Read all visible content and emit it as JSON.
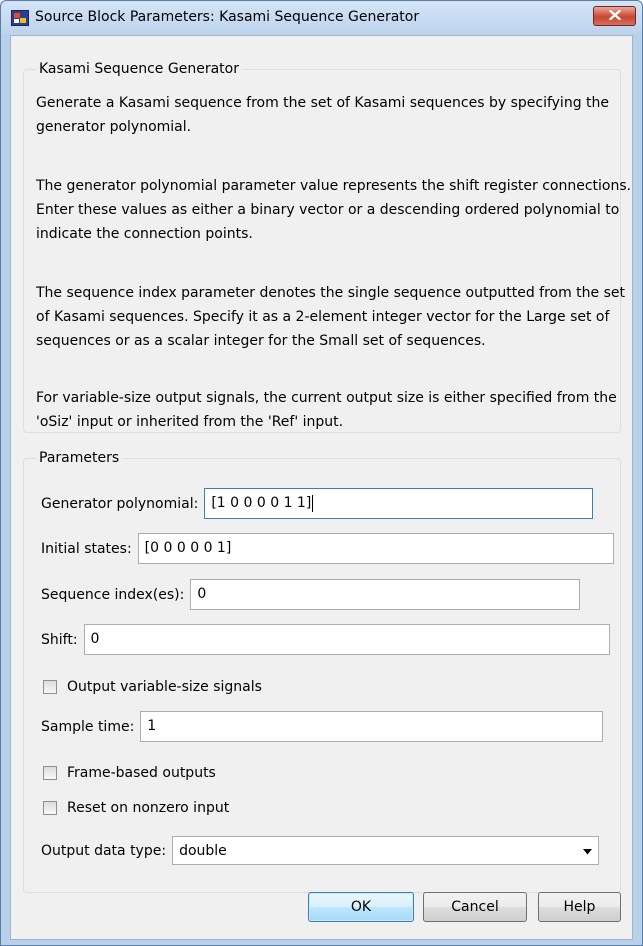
{
  "window": {
    "title": "Source Block Parameters: Kasami Sequence Generator",
    "close_glyph": "✕"
  },
  "description": {
    "legend": "Kasami Sequence Generator",
    "paragraphs": [
      "Generate a Kasami sequence from the set of Kasami sequences by specifying the generator polynomial.",
      "The generator polynomial parameter value represents the shift register connections. Enter these values as either a binary vector or a descending ordered polynomial to indicate the connection points.",
      "The sequence index parameter denotes the single sequence outputted from the set of Kasami sequences. Specify it as a 2-element integer vector for the Large set of sequences or as a scalar integer for the Small set of sequences.",
      "For variable-size output signals, the current output size is either specified from the 'oSiz' input or inherited from the 'Ref' input."
    ]
  },
  "parameters": {
    "legend": "Parameters",
    "generator_polynomial": {
      "label": "Generator polynomial:",
      "value": "[1 0 0 0 0 1 1]"
    },
    "initial_states": {
      "label": "Initial states:",
      "value": "[0 0 0 0 0 1]"
    },
    "sequence_index": {
      "label": "Sequence index(es):",
      "value": "0"
    },
    "shift": {
      "label": "Shift:",
      "value": "0"
    },
    "output_variable_size": {
      "label": "Output variable-size signals",
      "checked": false
    },
    "sample_time": {
      "label": "Sample time:",
      "value": "1"
    },
    "frame_based": {
      "label": "Frame-based outputs",
      "checked": false
    },
    "reset_nonzero": {
      "label": "Reset on nonzero input",
      "checked": false
    },
    "output_data_type": {
      "label": "Output data type:",
      "value": "double"
    }
  },
  "buttons": {
    "ok": "OK",
    "cancel": "Cancel",
    "help": "Help"
  },
  "icons": {
    "app": "simulink-block-icon",
    "close": "close-icon",
    "dropdown": "chevron-down-icon"
  }
}
